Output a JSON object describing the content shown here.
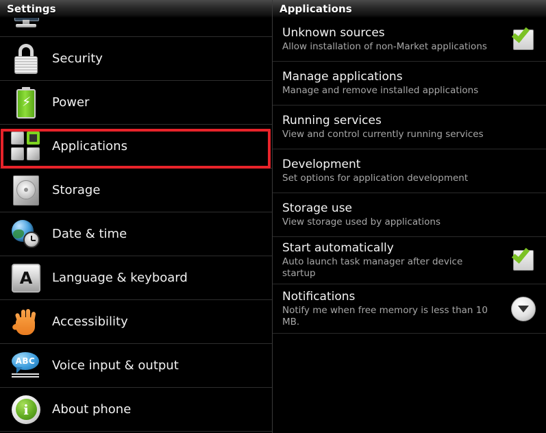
{
  "left_panel": {
    "title": "Settings",
    "items": [
      {
        "label": "",
        "icon": "monitor-icon",
        "partial": true
      },
      {
        "label": "Security",
        "icon": "lock-icon",
        "partial": false
      },
      {
        "label": "Power",
        "icon": "battery-icon",
        "partial": false
      },
      {
        "label": "Applications",
        "icon": "applications-grid-icon",
        "partial": false,
        "highlighted": true
      },
      {
        "label": "Storage",
        "icon": "hard-disk-icon",
        "partial": false
      },
      {
        "label": "Date & time",
        "icon": "globe-clock-icon",
        "partial": false
      },
      {
        "label": "Language & keyboard",
        "icon": "keyboard-key-a-icon",
        "partial": false
      },
      {
        "label": "Accessibility",
        "icon": "hand-icon",
        "partial": false
      },
      {
        "label": "Voice input & output",
        "icon": "speech-bubble-abc-icon",
        "partial": false
      },
      {
        "label": "About phone",
        "icon": "info-circle-icon",
        "partial": false
      }
    ]
  },
  "right_panel": {
    "title": "Applications",
    "items": [
      {
        "title": "Unknown sources",
        "subtitle": "Allow installation of non-Market applications",
        "control": "checkbox",
        "checked": true,
        "highlighted": true
      },
      {
        "title": "Manage applications",
        "subtitle": "Manage and remove installed applications",
        "control": "none"
      },
      {
        "title": "Running services",
        "subtitle": "View and control currently running services",
        "control": "none"
      },
      {
        "title": "Development",
        "subtitle": "Set options for application development",
        "control": "none"
      },
      {
        "title": "Storage use",
        "subtitle": "View storage used by applications",
        "control": "none"
      },
      {
        "title": "Start automatically",
        "subtitle": "Auto launch task manager after device startup",
        "control": "checkbox",
        "checked": true
      },
      {
        "title": "Notifications",
        "subtitle": "Notify me when free memory is less than 10 MB.",
        "control": "dropdown"
      }
    ]
  },
  "annotations": {
    "highlight_color": "#e8232a",
    "boxes": [
      {
        "name": "applications-sidebar-highlight"
      },
      {
        "name": "unknown-sources-highlight"
      }
    ]
  },
  "icons": {
    "checkbox_checked": "checkbox-checked-icon",
    "dropdown": "dropdown-circle-icon"
  }
}
